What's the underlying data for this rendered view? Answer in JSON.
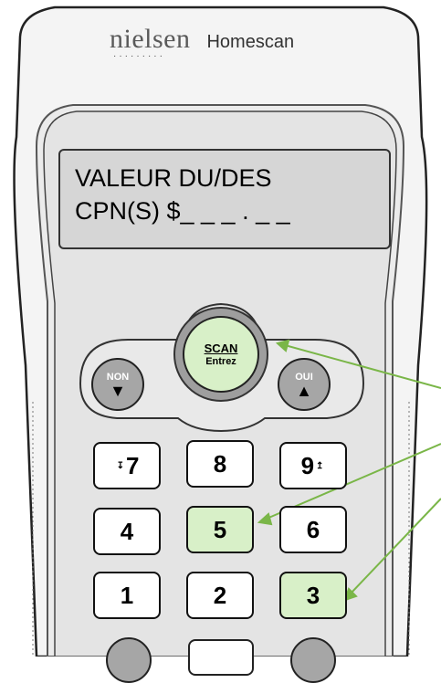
{
  "brand": {
    "name": "nielsen",
    "dots": "·········",
    "product": "Homescan"
  },
  "display": {
    "line1": "VALEUR DU/DES",
    "line2": "CPN(S) $_ _ _ . _ _"
  },
  "scan_button": {
    "label": "SCAN",
    "sublabel": "Entrez"
  },
  "non_button": {
    "label": "NON",
    "arrow": "▼"
  },
  "oui_button": {
    "label": "OUI",
    "arrow": "▲"
  },
  "keypad": {
    "row1": [
      {
        "digit": "7",
        "pre": "↧",
        "post": ""
      },
      {
        "digit": "8",
        "pre": "",
        "post": ""
      },
      {
        "digit": "9",
        "pre": "",
        "post": "↥"
      }
    ],
    "row2": [
      {
        "digit": "4"
      },
      {
        "digit": "5"
      },
      {
        "digit": "6"
      }
    ],
    "row3": [
      {
        "digit": "1"
      },
      {
        "digit": "2"
      },
      {
        "digit": "3"
      }
    ]
  },
  "colors": {
    "highlight": "#d8f0c8",
    "arrow": "#7ab648",
    "body": "#f4f4f4"
  }
}
